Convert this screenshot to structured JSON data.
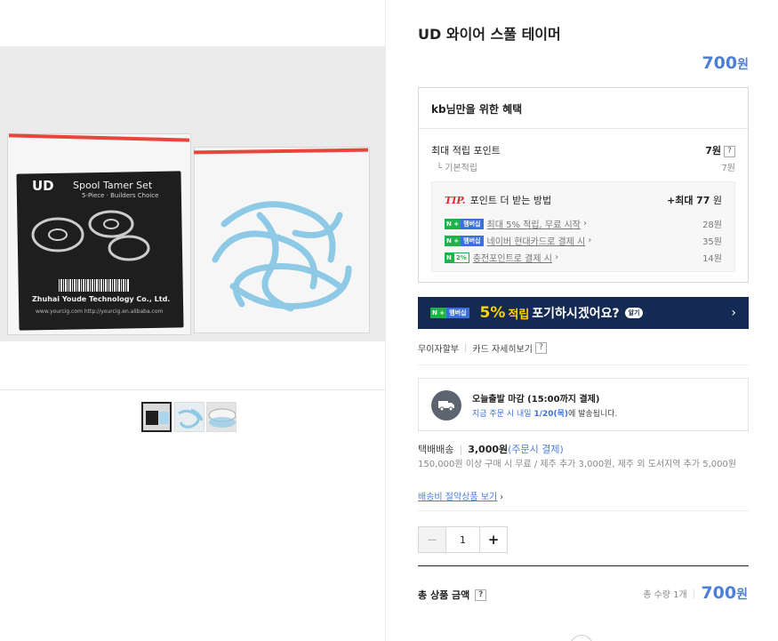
{
  "product": {
    "title": "UD 와이어 스풀 테이머",
    "price_value": "700",
    "price_unit": "원"
  },
  "gallery": {
    "image_brand": "UD",
    "image_product_name": "Spool Tamer Set",
    "image_sub": "5-Piece · Builders Choice",
    "image_maker": "Zhuhai Youde Technology Co., Ltd.",
    "image_url": "www.yourcig.com   http://yourcig.en.alibaba.com"
  },
  "benefits": {
    "heading": "kb님만을 위한 혜택",
    "max_points_label": "최대 적립 포인트",
    "max_points_value": "7원",
    "basic_label": "기본적립",
    "basic_value": "7원",
    "tip_label": "TIP.",
    "tip_title": "포인트 더 받는 방법",
    "tip_total_prefix": "+최대",
    "tip_total_num": "77",
    "tip_total_unit": "원",
    "tip_items": [
      {
        "badge": "멤버십",
        "text": "최대 5% 적립, 무료 시작",
        "value": "28원"
      },
      {
        "badge": "멤버십",
        "text": "네이버 현대카드로 결제 시",
        "value": "35원"
      },
      {
        "badge": "2%",
        "text": "충전포인트로 결제 시",
        "value": "14원"
      }
    ]
  },
  "banner": {
    "badge": "멤버십",
    "big": "5%",
    "mid": "적립",
    "question": "포기하시겠어요?",
    "pill": "알기",
    "arrow": "›"
  },
  "card_links": {
    "installment": "무이자할부",
    "card_detail": "카드 자세히보기"
  },
  "shipping": {
    "line1": "오늘출발 마감 (15:00까지 결제)",
    "line2_prefix": "지금 주문 시 내일",
    "line2_date": "1/20(목)",
    "line2_suffix": "에 발송됩니다.",
    "fee_label": "택배배송",
    "fee_amount": "3,000원",
    "fee_cond": "(주문시 결제)",
    "fee_desc": "150,000원 이상 구매 시 무료 / 제주 추가 3,000원, 제주 외 도서지역 추가 5,000원",
    "save_link": "배송비 절약상품 보기"
  },
  "quantity": {
    "minus": "−",
    "value": "1",
    "plus": "+"
  },
  "total": {
    "label": "총 상품 금액",
    "count": "총 수량 1개",
    "amount_value": "700",
    "amount_unit": "원"
  },
  "colors": {
    "accent_blue": "#4d7fd6",
    "banner_bg": "#142a52",
    "npay_green": "#1fb24a"
  }
}
